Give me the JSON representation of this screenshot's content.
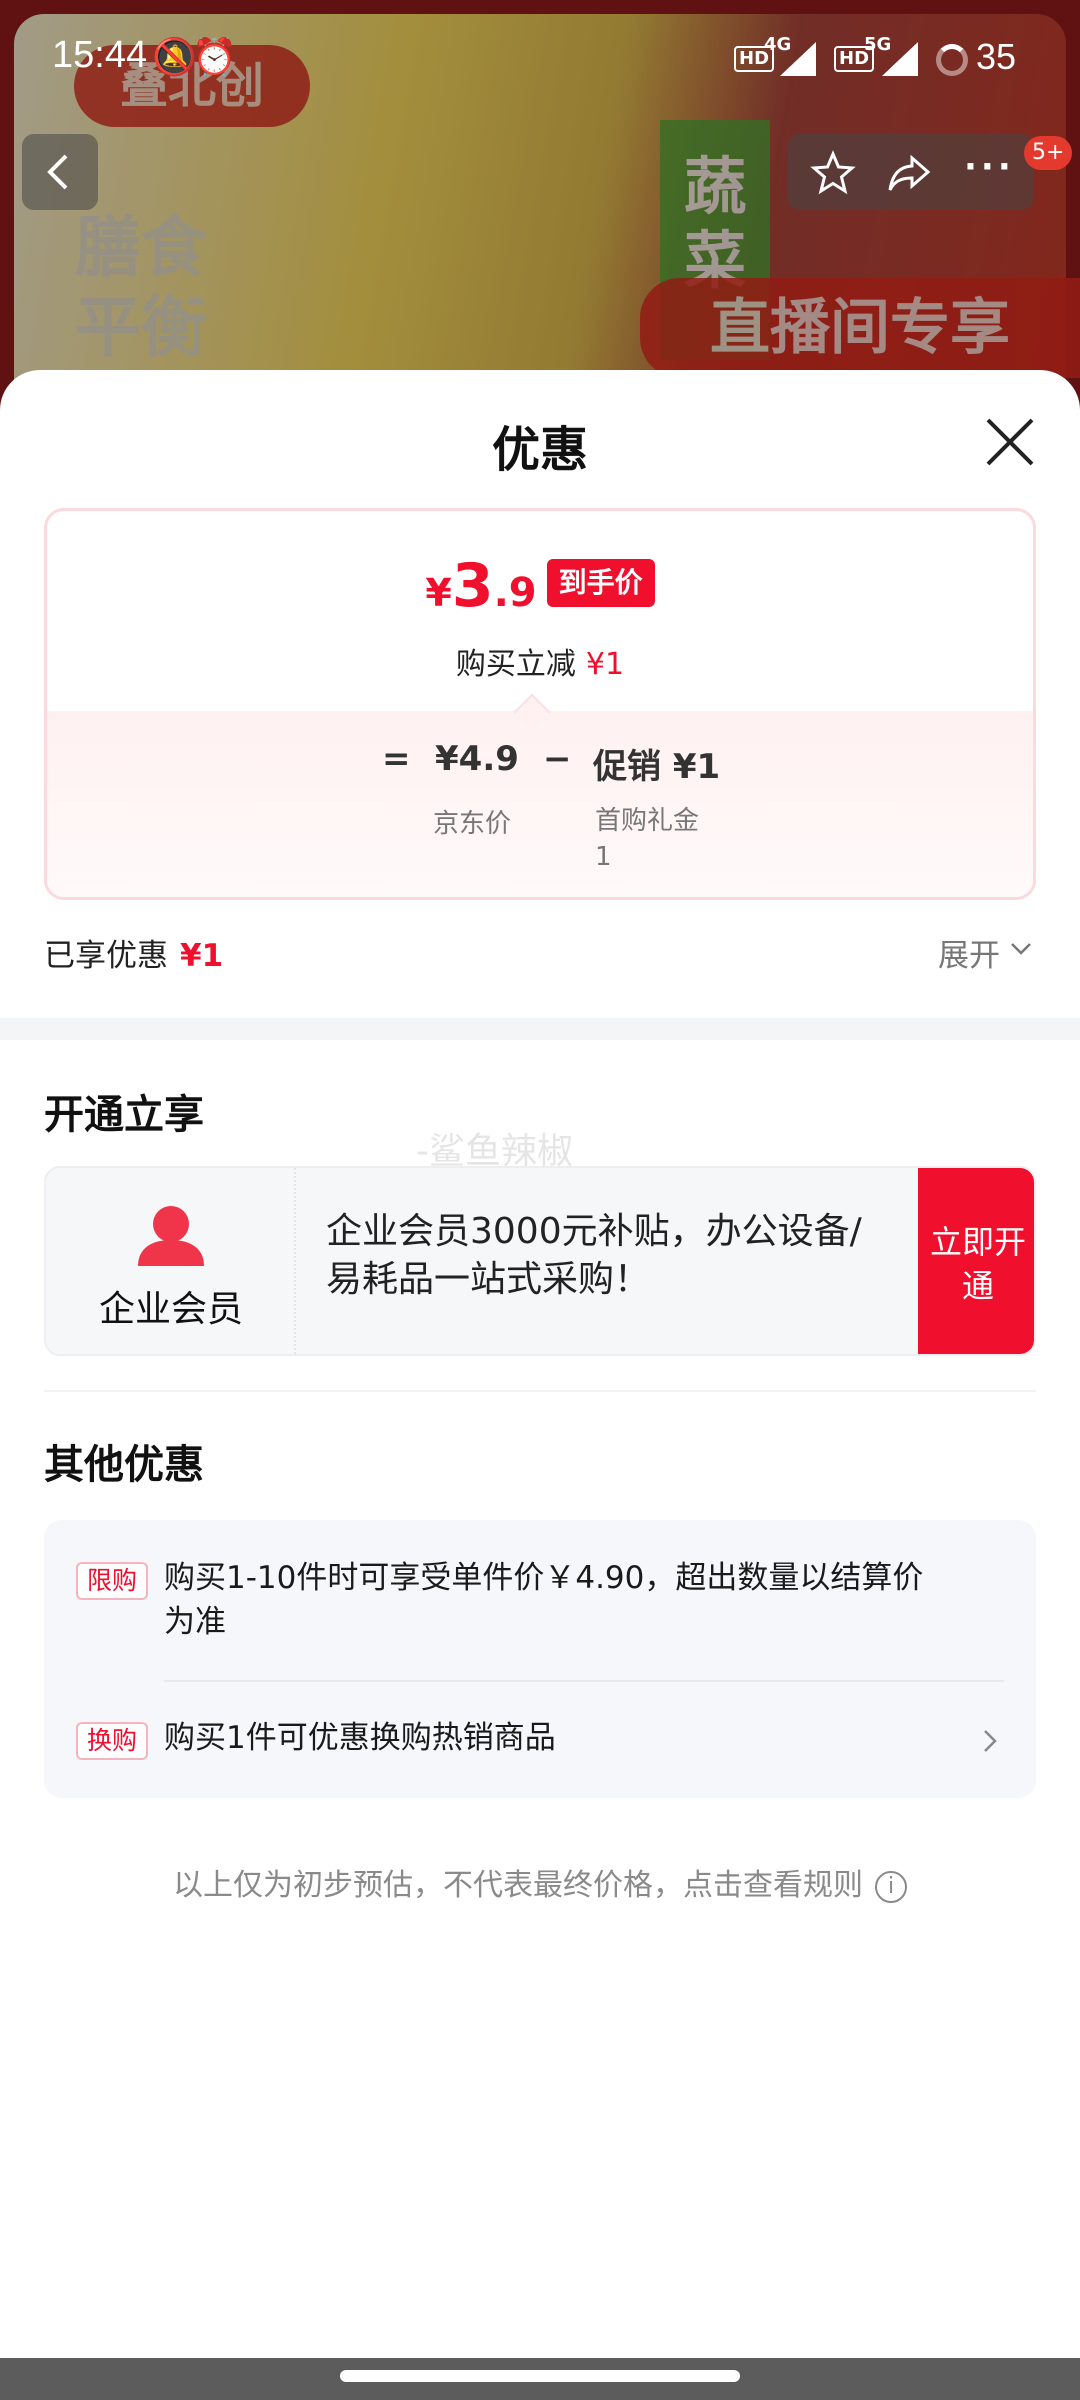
{
  "status_bar": {
    "time": "15:44",
    "net1": "4G",
    "net2": "5G",
    "hd": "HD",
    "battery": "35"
  },
  "background": {
    "brand": "叠北创",
    "slogan_line1": "膳食",
    "slogan_line2": "平衡",
    "veg_text": "蔬菜",
    "live_text": "直播间专享",
    "cart_badge": "5+"
  },
  "sheet": {
    "title": "优惠",
    "price": {
      "currency": "¥",
      "integer": "3",
      "decimal": ".9",
      "final_tag": "到手价",
      "reduce_label": "购买立减",
      "reduce_value": "¥1",
      "eq": "=",
      "jd_price": "¥4.9",
      "minus": "−",
      "promo": "促销 ¥1",
      "jd_label": "京东价",
      "promo_label": "首购礼金1"
    },
    "enjoyed_label": "已享优惠",
    "enjoyed_value": "¥1",
    "expand_label": "展开",
    "open_section": {
      "title": "开通立享",
      "watermark": "-鲨鱼辣椒",
      "member_name": "企业会员",
      "member_desc": "企业会员3000元补贴，办公设备/易耗品一站式采购！",
      "member_btn": "立即开通"
    },
    "other_section": {
      "title": "其他优惠",
      "items": [
        {
          "tag": "限购",
          "text": "购买1-10件时可享受单件价￥4.90，超出数量以结算价为准"
        },
        {
          "tag": "换购",
          "text": "购买1件可优惠换购热销商品"
        }
      ]
    },
    "disclaimer": "以上仅为初步预估，不代表最终价格，点击查看规则",
    "info_icon": "i"
  },
  "colors": {
    "accent_red": "#f0102e",
    "card_pink_border": "#fbd9dd"
  }
}
